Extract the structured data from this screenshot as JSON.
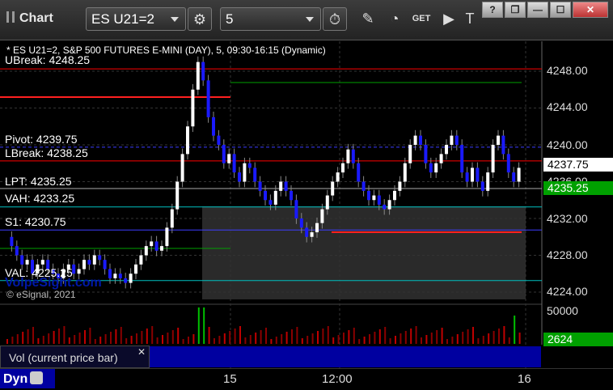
{
  "app": {
    "title": "Chart"
  },
  "toolbar": {
    "symbol": "ES U21=2",
    "interval": "5",
    "help": "?",
    "restore": "❐",
    "minimize": "—",
    "maximize": "☐",
    "close": "✕"
  },
  "chart": {
    "header": "* ES U21=2, S&P 500 FUTURES E-MINI (DAY), 5, 09:30-16:15 (Dynamic)",
    "watermark": "© eSignal, 2021",
    "brand": "VolpeSight.com",
    "levels": [
      {
        "label": "UBreak: 4248.25",
        "value": 4248.25
      },
      {
        "label": "Pivot: 4239.75",
        "value": 4239.75
      },
      {
        "label": "LBreak: 4238.25",
        "value": 4238.25
      },
      {
        "label": "LPT: 4235.25",
        "value": 4235.25
      },
      {
        "label": "VAH: 4233.25",
        "value": 4233.25
      },
      {
        "label": "S1: 4230.75",
        "value": 4230.75
      },
      {
        "label": "VAL: 4225.25",
        "value": 4225.25
      }
    ],
    "price_axis": [
      "4248.00",
      "4244.00",
      "4240.00",
      "4236.00",
      "4232.00",
      "4228.00",
      "4224.00"
    ],
    "last_price": "4237.75",
    "lpt_tag": "4235.25",
    "colors": {
      "up": "#ffffff",
      "down": "#1a1aff",
      "lpt": "#00c000",
      "ubreak": "#ff0000",
      "pivot": "#3c3cff",
      "vah": "#00bfbf"
    }
  },
  "time_axis": [
    "15",
    "12:00",
    "16"
  ],
  "volume": {
    "header": "Vol (current price bar)",
    "close_icon": "✕",
    "axis_max": "50000",
    "current": "2624"
  },
  "bottom": {
    "mode": "Dyn"
  }
}
